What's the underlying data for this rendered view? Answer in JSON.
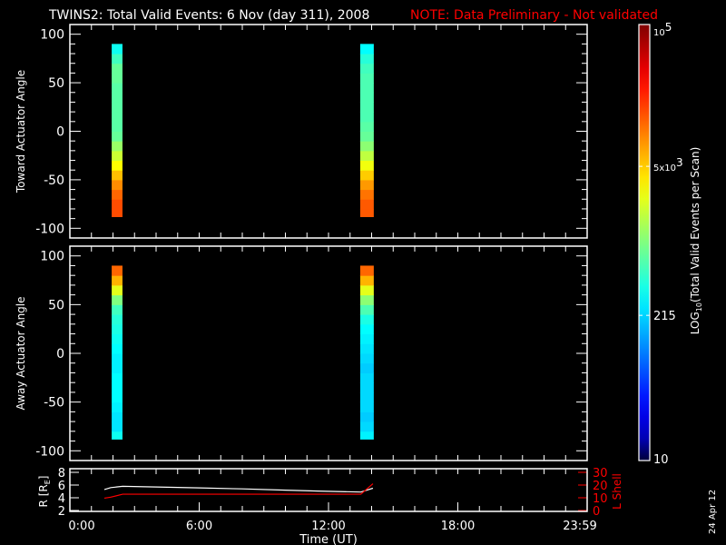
{
  "title": {
    "main": "TWINS2: Total Valid Events:  6 Nov (day 311), 2008",
    "note": "NOTE: Data Preliminary - Not validated",
    "note_color": "#ff0000"
  },
  "date_stamp": "24 Apr 12",
  "chart_data": [
    {
      "type": "heatmap",
      "name": "toward",
      "ylabel": "Toward Actuator Angle",
      "ylim": [
        -110,
        110
      ],
      "yticks": [
        -100,
        -50,
        0,
        50,
        100
      ],
      "xlim_hours": [
        0,
        24
      ],
      "angle_bins": [
        -85,
        -75,
        -65,
        -55,
        -45,
        -35,
        -25,
        -15,
        -5,
        5,
        15,
        25,
        35,
        45,
        55,
        65,
        75,
        85
      ],
      "scans": [
        {
          "t_start_h": 1.94,
          "t_end_h": 2.44,
          "log10_values": [
            4.2,
            4.2,
            4.1,
            3.95,
            3.75,
            3.5,
            3.3,
            3.1,
            2.9,
            2.85,
            2.85,
            2.85,
            2.85,
            2.85,
            2.9,
            2.9,
            2.75,
            2.55
          ]
        },
        {
          "t_start_h": 13.47,
          "t_end_h": 14.1,
          "log10_values": [
            4.15,
            4.15,
            4.05,
            3.9,
            3.7,
            3.45,
            3.25,
            3.05,
            2.9,
            2.85,
            2.8,
            2.8,
            2.8,
            2.8,
            2.8,
            2.75,
            2.65,
            2.5
          ]
        }
      ]
    },
    {
      "type": "heatmap",
      "name": "away",
      "ylabel": "Away Actuator Angle",
      "ylim": [
        -110,
        110
      ],
      "yticks": [
        -100,
        -50,
        0,
        50,
        100
      ],
      "xlim_hours": [
        0,
        24
      ],
      "angle_bins": [
        -85,
        -75,
        -65,
        -55,
        -45,
        -35,
        -25,
        -15,
        -5,
        5,
        15,
        25,
        35,
        45,
        55,
        65,
        75,
        85
      ],
      "scans": [
        {
          "t_start_h": 1.94,
          "t_end_h": 2.44,
          "log10_values": [
            2.55,
            2.4,
            2.4,
            2.45,
            2.5,
            2.5,
            2.5,
            2.45,
            2.45,
            2.5,
            2.55,
            2.6,
            2.65,
            2.75,
            3.0,
            3.4,
            3.8,
            4.1
          ]
        },
        {
          "t_start_h": 13.47,
          "t_end_h": 14.1,
          "log10_values": [
            2.45,
            2.35,
            2.3,
            2.35,
            2.35,
            2.35,
            2.35,
            2.3,
            2.35,
            2.4,
            2.45,
            2.5,
            2.6,
            2.8,
            3.05,
            3.4,
            3.8,
            4.1
          ]
        }
      ]
    },
    {
      "type": "line",
      "name": "ephemeris",
      "ylabel": "R [R_E]",
      "ylabel_main": "R [R",
      "ylabel_sub": "E",
      "ylabel_end": "]",
      "ylim": [
        2,
        8
      ],
      "yticks": [
        2,
        4,
        6,
        8
      ],
      "y2label": "L Shell",
      "y2lim": [
        0,
        30
      ],
      "y2ticks": [
        0,
        10,
        20,
        30
      ],
      "xlabel": "Time (UT)",
      "xticks": [
        {
          "h": 0,
          "label": "0:00"
        },
        {
          "h": 6,
          "label": "6:00"
        },
        {
          "h": 12,
          "label": "12:00"
        },
        {
          "h": 18,
          "label": "18:00"
        },
        {
          "h": 24,
          "label": "23:59"
        }
      ],
      "series": [
        {
          "name": "R",
          "axis": "left",
          "color": "#ffffff",
          "x": [
            1.6,
            1.9,
            2.45,
            4,
            6,
            8,
            10,
            11.5,
            13.5,
            14.06
          ],
          "y": [
            5.3,
            5.6,
            5.8,
            5.7,
            5.55,
            5.4,
            5.2,
            5.05,
            4.9,
            5.5
          ]
        },
        {
          "name": "L Shell",
          "axis": "right",
          "color": "#ff0000",
          "x": [
            1.6,
            1.9,
            2.45,
            13.5,
            14.06
          ],
          "y": [
            9.7,
            10.5,
            12.8,
            12.8,
            21
          ]
        }
      ]
    }
  ],
  "colorbar": {
    "label_main": "LOG",
    "label_sub": "10",
    "label_end": "(Total Valid  Events  per Scan)",
    "range_log10": [
      1,
      5
    ],
    "ticks": [
      {
        "log10": 5,
        "label": "10",
        "sup": "5"
      },
      {
        "log10": 3.699,
        "label": "5x10",
        "sup": "3"
      },
      {
        "log10": 2.332,
        "label": "215"
      },
      {
        "log10": 1,
        "label": "10"
      }
    ]
  }
}
